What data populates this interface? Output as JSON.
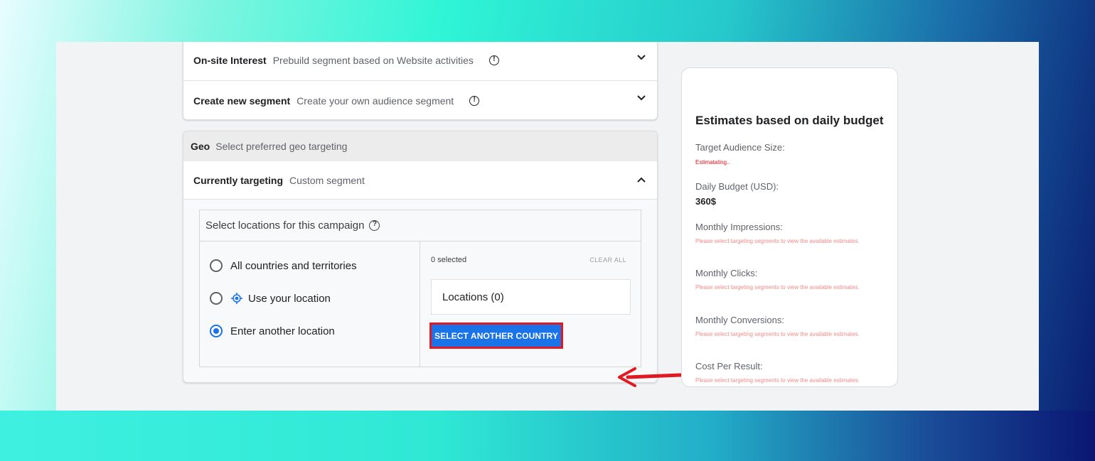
{
  "segments": [
    {
      "title": "On-site Interest",
      "subtitle": "Prebuild segment based on Website activities"
    },
    {
      "title": "Create new segment",
      "subtitle": "Create your own audience segment"
    }
  ],
  "geo": {
    "title": "Geo",
    "subtitle": "Select preferred geo targeting",
    "current_label": "Currently targeting",
    "current_value": "Custom segment",
    "panel_title": "Select locations for this campaign",
    "options": [
      "All countries and territories",
      "Use your location",
      "Enter another location"
    ],
    "selected_option": "Enter another location",
    "selected_count": "0 selected",
    "clear_all": "CLEAR ALL",
    "locations": "Locations (0)",
    "select_country_button": "SELECT ANOTHER COUNTRY"
  },
  "estimates": {
    "title": "Estimates based on daily budget",
    "audience_label": "Target Audience Size:",
    "audience_value": "Estimatating..",
    "budget_label": "Daily Budget (USD):",
    "budget_value": "360$",
    "impressions_label": "Monthly Impressions:",
    "clicks_label": "Monthly Clicks:",
    "conversions_label": "Monthly Conversions:",
    "cost_label": "Cost Per Result:",
    "note": "Please select targeting segments to view the available estimates."
  },
  "colors": {
    "accent": "#1a73e8",
    "highlight": "#e01a22",
    "error": "#e8101a"
  }
}
